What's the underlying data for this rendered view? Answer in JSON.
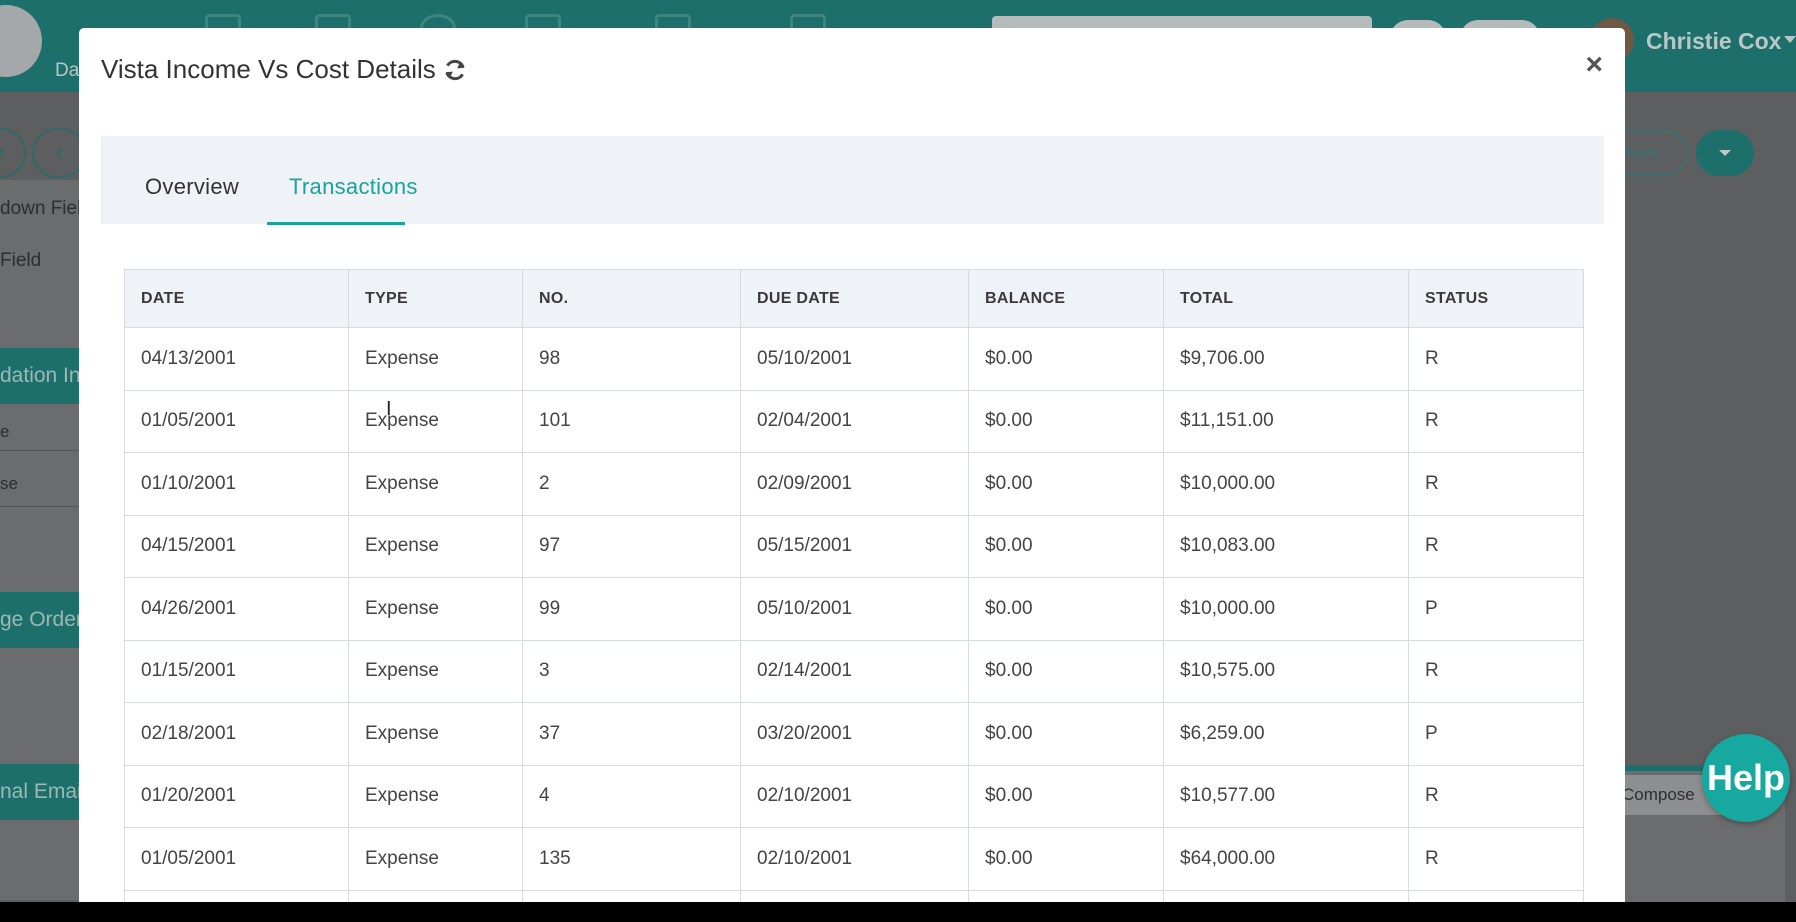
{
  "background": {
    "nav_label": "Da",
    "user_name": "Christie Cox",
    "save_label": "Save",
    "left_items": [
      "down Fiel",
      "Field",
      "dation Inc",
      "e",
      "se",
      "ge Order",
      "nal Email"
    ],
    "compose_label": "Compose"
  },
  "modal": {
    "title": "Vista Income Vs Cost Details",
    "close_glyph": "×",
    "tabs": [
      {
        "label": "Overview",
        "active": false
      },
      {
        "label": "Transactions",
        "active": true
      }
    ],
    "table": {
      "headers": [
        "DATE",
        "TYPE",
        "NO.",
        "DUE DATE",
        "BALANCE",
        "TOTAL",
        "STATUS"
      ],
      "rows": [
        [
          "04/13/2001",
          "Expense",
          "98",
          "05/10/2001",
          "$0.00",
          "$9,706.00",
          "R"
        ],
        [
          "01/05/2001",
          "Expense",
          "101",
          "02/04/2001",
          "$0.00",
          "$11,151.00",
          "R"
        ],
        [
          "01/10/2001",
          "Expense",
          "2",
          "02/09/2001",
          "$0.00",
          "$10,000.00",
          "R"
        ],
        [
          "04/15/2001",
          "Expense",
          "97",
          "05/15/2001",
          "$0.00",
          "$10,083.00",
          "R"
        ],
        [
          "04/26/2001",
          "Expense",
          "99",
          "05/10/2001",
          "$0.00",
          "$10,000.00",
          "P"
        ],
        [
          "01/15/2001",
          "Expense",
          "3",
          "02/14/2001",
          "$0.00",
          "$10,575.00",
          "R"
        ],
        [
          "02/18/2001",
          "Expense",
          "37",
          "03/20/2001",
          "$0.00",
          "$6,259.00",
          "P"
        ],
        [
          "01/20/2001",
          "Expense",
          "4",
          "02/10/2001",
          "$0.00",
          "$10,577.00",
          "R"
        ],
        [
          "01/05/2001",
          "Expense",
          "135",
          "02/10/2001",
          "$0.00",
          "$64,000.00",
          "R"
        ]
      ]
    }
  },
  "help": {
    "label": "Help"
  },
  "colors": {
    "accent": "#1aa39a",
    "nav": "#1d6f6b",
    "header_bg": "#eff2f6"
  }
}
